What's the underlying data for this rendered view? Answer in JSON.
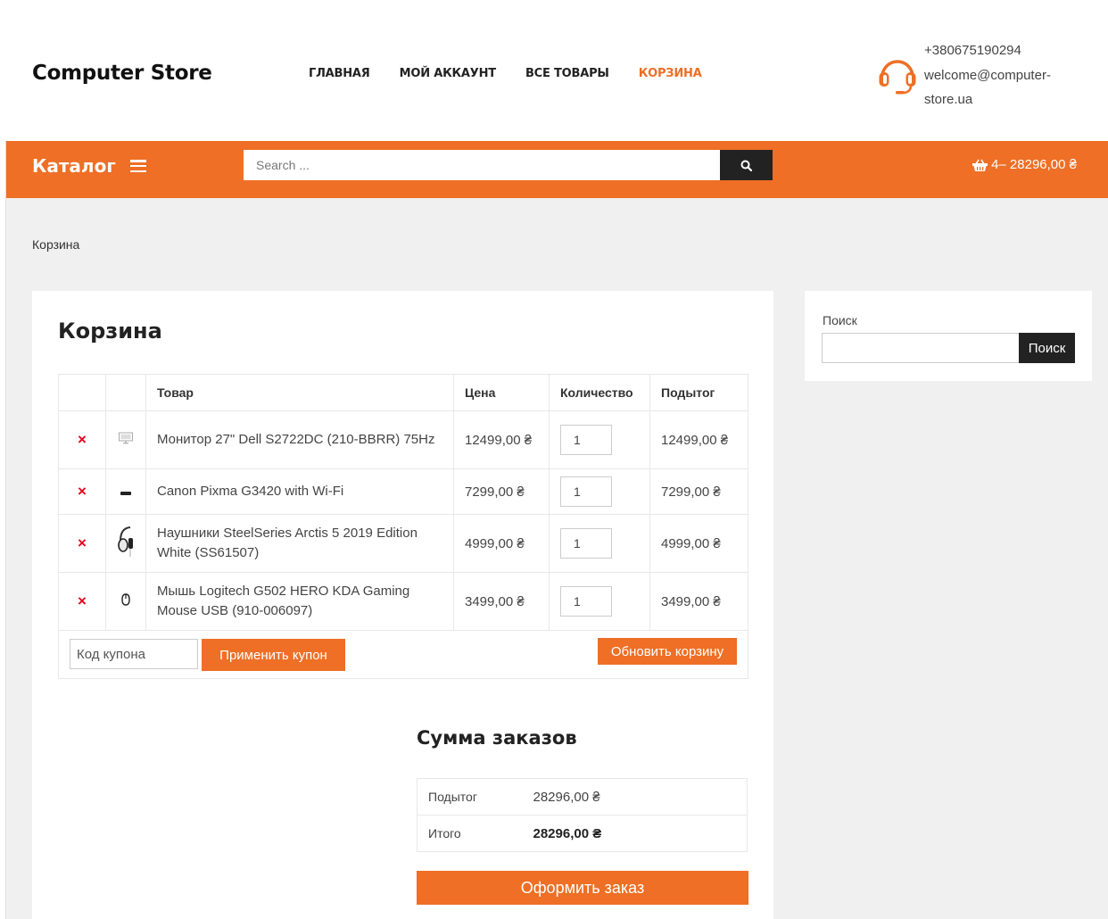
{
  "header": {
    "logo": "Computer Store",
    "nav": [
      {
        "label": "ГЛАВНАЯ"
      },
      {
        "label": "МОЙ АККАУНТ"
      },
      {
        "label": "ВСЕ ТОВАРЫ"
      },
      {
        "label": "КОРЗИНА",
        "active": true
      }
    ],
    "phone": "+380675190294",
    "email_line1": "welcome@computer-",
    "email_line2": "store.ua"
  },
  "bar": {
    "catalog_label": "Каталог",
    "search_placeholder": "Search ...",
    "cart_summary": "4– 28296,00 ₴"
  },
  "breadcrumb": "Корзина",
  "cart": {
    "title": "Корзина",
    "columns": {
      "product": "Товар",
      "price": "Цена",
      "qty": "Количество",
      "subtotal": "Подытог"
    },
    "items": [
      {
        "remove": "×",
        "name": "Монитор 27\" Dell S2722DC (210-BBRR) 75Hz",
        "price": "12499,00 ₴",
        "qty": "1",
        "subtotal": "12499,00 ₴",
        "thumb": "monitor-thumbnail"
      },
      {
        "remove": "×",
        "name": "Canon Pixma G3420 with Wi-Fi",
        "price": "7299,00 ₴",
        "qty": "1",
        "subtotal": "7299,00 ₴",
        "thumb": "printer-thumbnail"
      },
      {
        "remove": "×",
        "name": "Наушники SteelSeries Arctis 5 2019 Edition White (SS61507)",
        "price": "4999,00 ₴",
        "qty": "1",
        "subtotal": "4999,00 ₴",
        "thumb": "headphones-thumbnail"
      },
      {
        "remove": "×",
        "name": "Мышь Logitech G502 HERO KDA Gaming Mouse USB (910-006097)",
        "price": "3499,00 ₴",
        "qty": "1",
        "subtotal": "3499,00 ₴",
        "thumb": "mouse-thumbnail"
      }
    ],
    "coupon_placeholder": "Код купона",
    "apply_coupon": "Применить купон",
    "update_cart": "Обновить корзину"
  },
  "totals": {
    "title": "Сумма заказов",
    "subtotal_label": "Подытог",
    "subtotal_value": "28296,00 ₴",
    "total_label": "Итого",
    "total_value": "28296,00 ₴",
    "checkout": "Оформить заказ"
  },
  "sidebar": {
    "label": "Поиск",
    "button": "Поиск"
  },
  "colors": {
    "accent": "#ee6f25",
    "dark": "#222222",
    "remove": "#e2001a",
    "background": "#f0f0f0"
  }
}
